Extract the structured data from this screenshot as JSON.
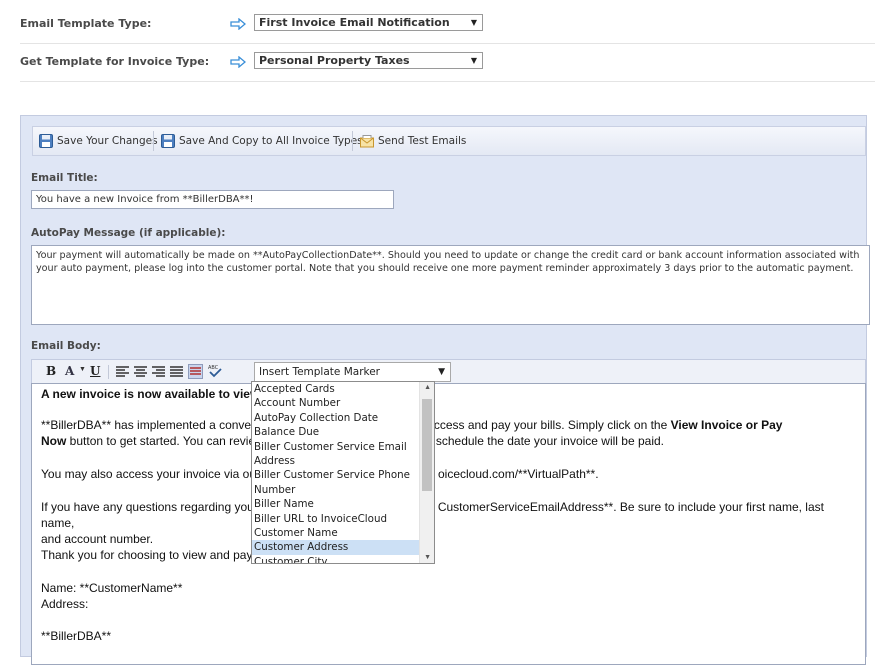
{
  "header": {
    "template_type_label": "Email Template Type:",
    "template_type_value": "First Invoice Email Notification",
    "invoice_type_label": "Get Template for Invoice Type:",
    "invoice_type_value": "Personal Property Taxes"
  },
  "toolbar": {
    "save_label": "Save Your Changes",
    "save_copy_label": "Save And Copy to All Invoice Types",
    "send_test_label": "Send Test Emails"
  },
  "form": {
    "email_title_label": "Email Title:",
    "email_title_value": "You have a new Invoice from **BillerDBA**!",
    "autopay_label": "AutoPay Message (if applicable):",
    "autopay_value": "Your payment will automatically be made on **AutoPayCollectionDate**. Should you need to update or change the credit card or bank account information associated with your auto payment, please log into the customer portal. Note that you should receive one more payment reminder approximately 3 days prior to the automatic payment.",
    "email_body_label": "Email Body:"
  },
  "editor": {
    "bold": "B",
    "font_color": "A",
    "underline": "U",
    "marker_select": "Insert Template Marker",
    "body": {
      "line1": "A new invoice is now available to view",
      "p2a": "**BillerDBA** has implemented a conven",
      "p2b": "em for you to access and pay your bills. Simply click on the ",
      "p2bold": "View Invoice or Pay",
      "p2c_bold": "Now",
      "p2c": " button to get started. You can reviev",
      "p2d": "nically now, or schedule the date your invoice will be paid.",
      "p3a": "You may also access your invoice via our",
      "p3b": "oicecloud.com/**VirtualPath**.",
      "p4a": "If you have any questions regarding your",
      "p4b": "CustomerServiceEmailAddress**. Be sure to include your first name, last name,",
      "p4c": "and account number.",
      "p5a": "Thank you for choosing to view and pay c",
      "p6": "Name: **CustomerName**",
      "p7": "Address:",
      "p8": "**BillerDBA**"
    }
  },
  "dropdown": {
    "items": [
      "Accepted Cards",
      "Account Number",
      "AutoPay Collection Date",
      "Balance Due",
      "Biller Customer Service Email",
      "Address",
      "Biller Customer Service Phone",
      "Number",
      "Biller Name",
      "Biller URL to InvoiceCloud",
      "Customer Name",
      "Customer Address",
      "Customer City"
    ],
    "highlighted_index": 11
  },
  "colors": {
    "accent": "#3a8fd8",
    "panel": "#dfe6f5",
    "highlight": "#cce0f5"
  }
}
